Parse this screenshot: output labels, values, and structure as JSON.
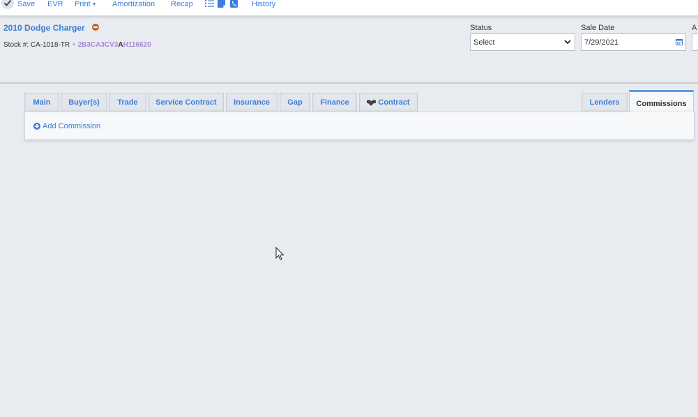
{
  "toolbar": {
    "save": "Save",
    "evr": "EVR",
    "print": "Print",
    "amortization": "Amortization",
    "recap": "Recap",
    "history": "History",
    "icons": [
      "checklist-icon",
      "note-icon",
      "phone-icon"
    ]
  },
  "vehicle": {
    "title": "2010 Dodge Charger",
    "stock_label": "Stock #:",
    "stock_number": "CA-1018-TR",
    "vin_part1": "2B3CA3CV3",
    "vin_part2": "A",
    "vin_part3": "H116620"
  },
  "fields": {
    "status_label": "Status",
    "status_value": "Select",
    "sale_date_label": "Sale Date",
    "sale_date_value": "7/29/2021",
    "third_label": "A"
  },
  "tabs": {
    "left": [
      "Main",
      "Buyer(s)",
      "Trade",
      "Service Contract",
      "Insurance",
      "Gap",
      "Finance",
      "Contract"
    ],
    "right": [
      "Lenders",
      "Commissions"
    ],
    "active": "Commissions"
  },
  "panel": {
    "add_commission": "Add Commission"
  },
  "colors": {
    "accent": "#3b7dd8",
    "vin_highlight": "#a78bd6",
    "active_tab_border": "#5b9be6",
    "background": "#e8ebf0"
  }
}
